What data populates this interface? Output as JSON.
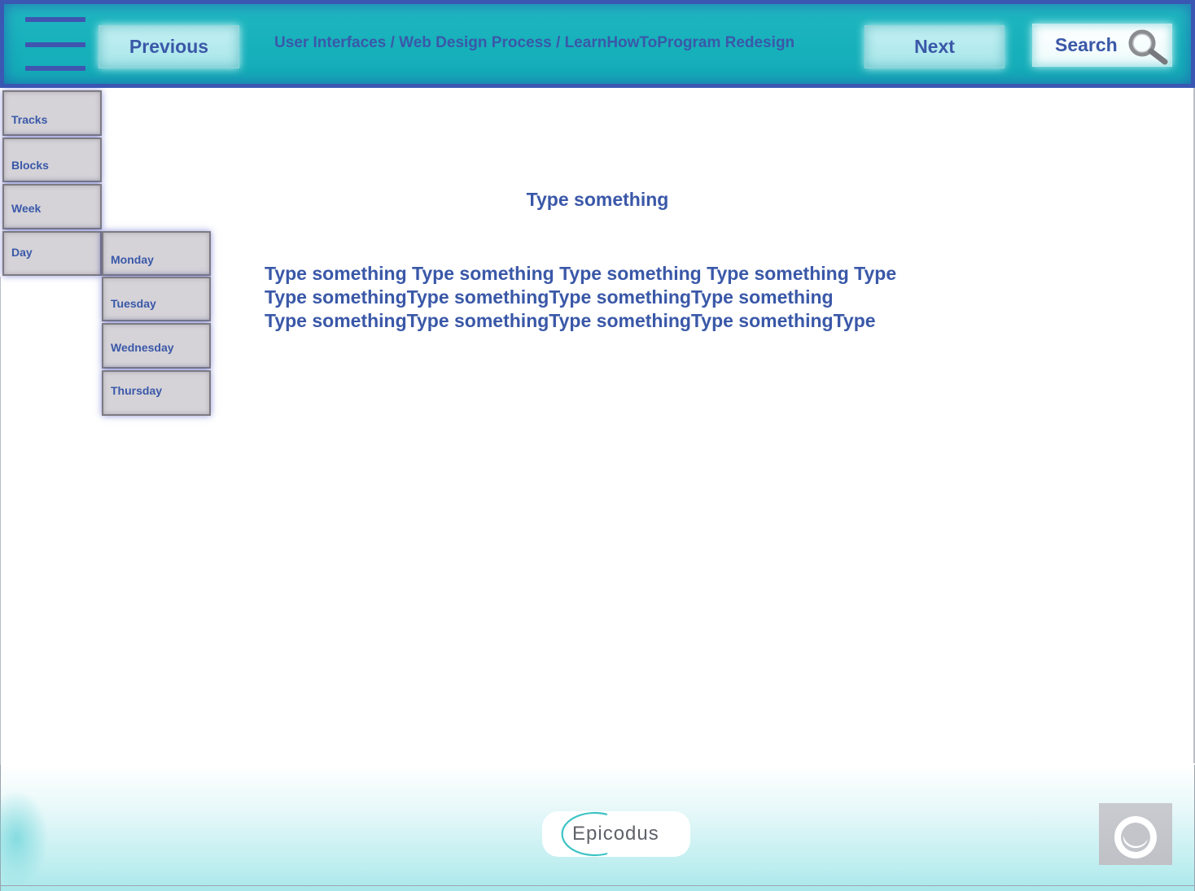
{
  "header": {
    "previous_label": "Previous",
    "breadcrumb": "User Interfaces / Web Design Process / LearnHowToProgram Redesign",
    "next_label": "Next",
    "search_label": "Search",
    "menu_icon": "hamburger-menu-icon",
    "search_icon": "magnifying-glass-icon"
  },
  "nav": {
    "items": [
      {
        "label": "Tracks"
      },
      {
        "label": "Blocks"
      },
      {
        "label": "Week"
      },
      {
        "label": "Day"
      }
    ],
    "day_submenu": [
      {
        "label": "Monday"
      },
      {
        "label": "Tuesday"
      },
      {
        "label": "Wednesday"
      },
      {
        "label": "Thursday"
      }
    ]
  },
  "main": {
    "title": "Type something",
    "body_lines": [
      "Type something Type something Type something Type something Type",
      "Type somethingType somethingType somethingType something",
      "Type somethingType somethingType somethingType somethingType"
    ]
  },
  "footer": {
    "logo_text": "Epicodus",
    "corner_icon": "circle-swirl-icon"
  },
  "colors": {
    "header_teal": "#16b0bb",
    "header_border": "#3a57b3",
    "text_blue": "#3a58a8",
    "nav_gray": "#d5d3d8",
    "button_light": "#a8e6ea",
    "logo_teal": "#3cc3c4"
  }
}
